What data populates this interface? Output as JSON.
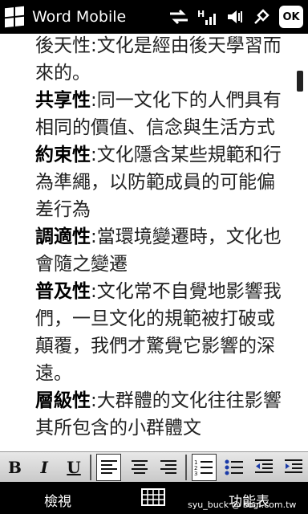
{
  "title_bar": {
    "app_title": "Word Mobile",
    "ok_label": "OK",
    "icons": [
      "windows-logo-icon",
      "sync-icon",
      "signal-icon",
      "speaker-icon",
      "charging-icon"
    ]
  },
  "document": {
    "paragraphs": [
      {
        "term": "",
        "text": "後天性:文化是經由後天學習而來的。"
      },
      {
        "term": "共享性",
        "text": ":同一文化下的人們具有相同的價值、信念與生活方式"
      },
      {
        "term": "約束性",
        "text": ":文化隱含某些規範和行為準繩，以防範成員的可能偏差行為"
      },
      {
        "term": "調適性",
        "text": ":當環境變遷時，文化也會隨之變遷"
      },
      {
        "term": "普及性",
        "text": ":文化常不自覺地影響我們，一旦文化的規範被打破或顛覆，我們才驚覺它影響的深遠。"
      },
      {
        "term": "層級性",
        "text": ":大群體的文化往往影響其所包含的小群體文"
      }
    ]
  },
  "toolbar": {
    "bold": "B",
    "italic": "I",
    "underline": "U",
    "icons": [
      "align-left-icon",
      "align-center-icon",
      "align-right-icon",
      "numbered-list-icon",
      "bulleted-list-icon",
      "decrease-indent-icon",
      "increase-indent-icon"
    ]
  },
  "softkeys": {
    "left": "檢視",
    "right": "功能表",
    "center_icon": "keyboard-icon"
  },
  "watermark": "syu_buck @ sogi.com.tw"
}
